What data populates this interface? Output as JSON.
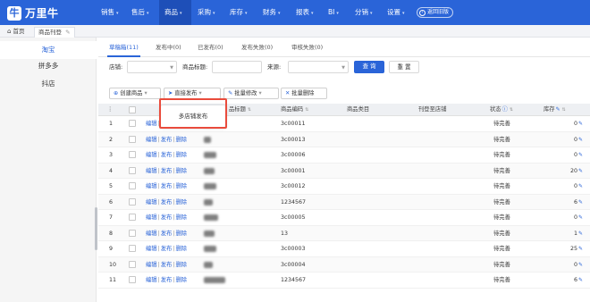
{
  "app": {
    "logo_text": "万里牛",
    "logo_mark": "牛"
  },
  "nav": {
    "items": [
      {
        "label": "销售",
        "caret": "▾"
      },
      {
        "label": "售后",
        "caret": "▾"
      },
      {
        "label": "商品",
        "caret": "▾"
      },
      {
        "label": "采购",
        "caret": "▾"
      },
      {
        "label": "库存",
        "caret": "▾"
      },
      {
        "label": "财务",
        "caret": "▾"
      },
      {
        "label": "报表",
        "caret": "▾"
      },
      {
        "label": "BI",
        "caret": "▾"
      },
      {
        "label": "分销",
        "caret": "▾"
      },
      {
        "label": "设置",
        "caret": "▾"
      }
    ],
    "active_index": 2,
    "back_label": "返回旧版"
  },
  "tabstrip": {
    "home_label": "首页",
    "current_label": "商品刊登"
  },
  "sidebar": {
    "items": [
      "淘宝",
      "拼多多",
      "抖店"
    ],
    "active_index": 0
  },
  "subtabs": [
    {
      "label": "草稿箱(11)"
    },
    {
      "label": "发布中(0)"
    },
    {
      "label": "已发布(0)"
    },
    {
      "label": "发布失败(0)"
    },
    {
      "label": "审核失败(0)"
    }
  ],
  "filters": {
    "shop_label": "店铺:",
    "title_label": "商品标题:",
    "source_label": "来源:",
    "query_button": "查 询",
    "reset_button": "重 置"
  },
  "actions": {
    "create": "创建商品",
    "publish": "直接发布",
    "batch_edit": "批量修改",
    "batch_delete": "批量删除"
  },
  "popup": {
    "label": "多店铺发布"
  },
  "table": {
    "headers": {
      "title": "品标题",
      "code": "商品编码",
      "category": "商品类目",
      "store": "刊登至店铺",
      "status": "状态",
      "stock": "库存"
    },
    "ops": {
      "edit": "编辑",
      "publish": "发布",
      "delete": "删除",
      "sep": "|"
    },
    "rows": [
      {
        "no": "1",
        "code": "3c00011",
        "status": "待完善",
        "stock": "0"
      },
      {
        "no": "2",
        "code": "3c00013",
        "status": "待完善",
        "stock": "0"
      },
      {
        "no": "3",
        "code": "3c00006",
        "status": "待完善",
        "stock": "0"
      },
      {
        "no": "4",
        "code": "3c00001",
        "status": "待完善",
        "stock": "20"
      },
      {
        "no": "5",
        "code": "3c00012",
        "status": "待完善",
        "stock": "0"
      },
      {
        "no": "6",
        "code": "1234567",
        "status": "待完善",
        "stock": "6"
      },
      {
        "no": "7",
        "code": "3c00005",
        "status": "待完善",
        "stock": "0"
      },
      {
        "no": "8",
        "code": "13",
        "status": "待完善",
        "stock": "1"
      },
      {
        "no": "9",
        "code": "3c00003",
        "status": "待完善",
        "stock": "25"
      },
      {
        "no": "10",
        "code": "3c00004",
        "status": "待完善",
        "stock": "0"
      },
      {
        "no": "11",
        "code": "1234567",
        "status": "待完善",
        "stock": "6"
      }
    ]
  },
  "colors": {
    "brand": "#2a64d8",
    "highlight": "#e94b3c"
  }
}
